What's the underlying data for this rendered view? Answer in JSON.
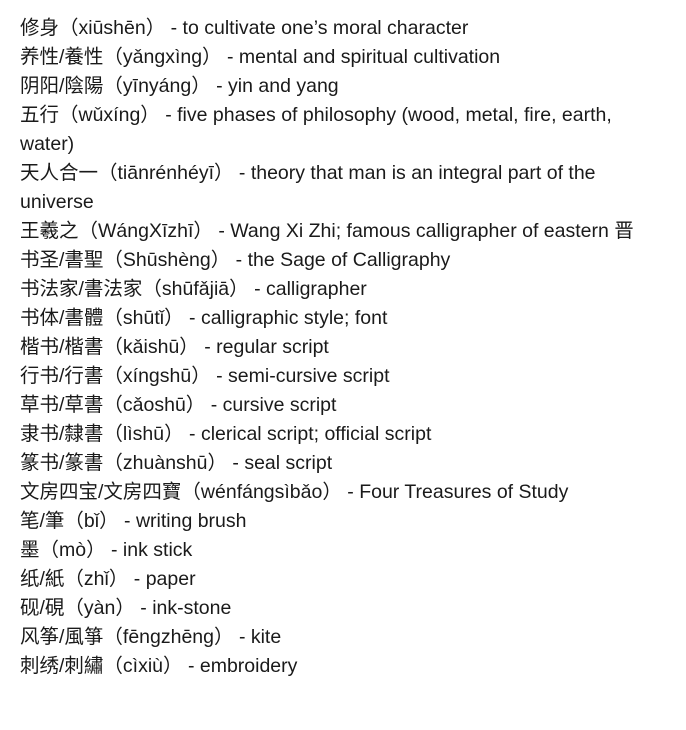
{
  "entries": [
    {
      "term": "修身（xiūshēn）",
      "definition": "- to cultivate one’s moral character"
    },
    {
      "term": "养性/養性（yǎngxìng）",
      "definition": "- mental and spiritual cultivation"
    },
    {
      "term": "阴阳/陰陽（yīnyáng）",
      "definition": "- yin and yang"
    },
    {
      "term": "五行（wǔxíng）",
      "definition": "- five phases of philosophy (wood, metal, fire, earth, water)"
    },
    {
      "term": "天人合一（tiānrénhéyī）",
      "definition": "- theory that man is an integral part of the universe"
    },
    {
      "term": "王羲之（WángXīzhī）",
      "definition": "- Wang Xi Zhi; famous calligrapher of eastern 晋"
    },
    {
      "term": "书圣/書聖（Shūshèng）",
      "definition": "- the Sage of Calligraphy"
    },
    {
      "term": "书法家/書法家（shūfǎjiā）",
      "definition": "- calligrapher"
    },
    {
      "term": "书体/書體（shūtǐ）",
      "definition": "- calligraphic style; font"
    },
    {
      "term": "楷书/楷書（kǎishū）",
      "definition": "- regular script"
    },
    {
      "term": "行书/行書（xíngshū）",
      "definition": "- semi-cursive script"
    },
    {
      "term": "草书/草書（cǎoshū）",
      "definition": "- cursive script"
    },
    {
      "term": "隶书/隸書（lìshū）",
      "definition": "- clerical script; official script"
    },
    {
      "term": "篆书/篆書（zhuànshū）",
      "definition": "- seal script"
    },
    {
      "term": "文房四宝/文房四寶（wénfángsìbǎo）",
      "definition": "- Four Treasures of Study"
    },
    {
      "term": "笔/筆（bǐ）",
      "definition": "- writing brush"
    },
    {
      "term": "墨（mò）",
      "definition": "- ink stick"
    },
    {
      "term": "纸/紙（zhǐ）",
      "definition": "- paper"
    },
    {
      "term": "砚/硯（yàn）",
      "definition": "- ink-stone"
    },
    {
      "term": "风筝/風箏（fēngzhēng）",
      "definition": "- kite"
    },
    {
      "term": "刺绣/刺繡（cìxiù）",
      "definition": "- embroidery"
    }
  ]
}
